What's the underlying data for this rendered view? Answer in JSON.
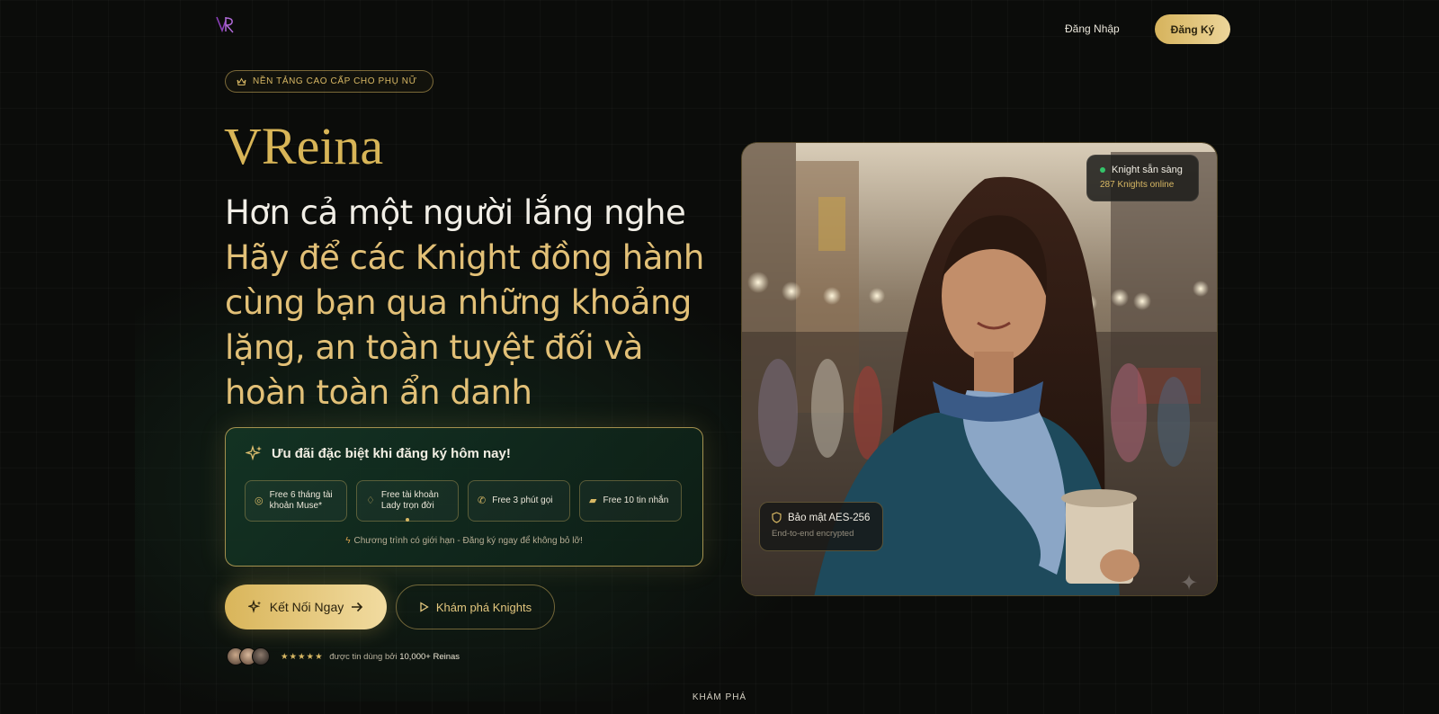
{
  "nav": {
    "login_label": "Đăng Nhập",
    "signup_label": "Đăng Ký",
    "logo_icon": "vr-monogram-logo"
  },
  "hero": {
    "badge_icon": "crown-icon",
    "badge_text": "NỀN TẢNG CAO CẤP CHO PHỤ NỮ",
    "brand": "VReina",
    "headline_line1": "Hơn cả một người lắng nghe",
    "headline_line2": "Hãy để các Knight đồng hành cùng bạn qua những khoảng lặng, an toàn tuyệt đối và hoàn toàn ẩn danh"
  },
  "offer": {
    "title_icon": "sparkles-icon",
    "title": "Ưu đãi đặc biệt khi đăng ký hôm nay!",
    "chips": [
      {
        "icon": "spiral-icon",
        "label": "Free 6 tháng tài khoản Muse*"
      },
      {
        "icon": "diamond-icon",
        "label": "Free tài khoản Lady trọn đời"
      },
      {
        "icon": "phone-icon",
        "label": "Free 3 phút gọi"
      },
      {
        "icon": "chat-icon",
        "label": "Free 10 tin nhắn"
      }
    ],
    "note_icon": "flash-icon",
    "note": "Chương trình có giới hạn - Đăng ký ngay để không bỏ lỡ!"
  },
  "cta": {
    "primary_label": "Kết Nối Ngay",
    "secondary_label": "Khám phá Knights"
  },
  "trust": {
    "stars": "★★★★★",
    "prefix": "được tin dùng bởi",
    "count": "10,000+ Reinas"
  },
  "photo_overlay": {
    "status_title": "Knight sẵn sàng",
    "status_count": "287 Knights online",
    "security_title": "Bảo mật AES-256",
    "security_sub": "End-to-end encrypted"
  },
  "footer": {
    "explore_label": "KHÁM PHÁ"
  },
  "colors": {
    "gold": "#d8b557",
    "bg": "#0b0c0a",
    "online": "#34c46a",
    "card_green": "#143424"
  }
}
